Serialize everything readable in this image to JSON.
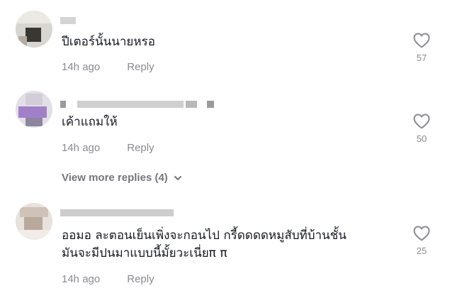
{
  "comments": [
    {
      "text_lines": [
        "ปีเตอร์นั้นนายหรอ"
      ],
      "time": "14h ago",
      "reply": "Reply",
      "likes": "57"
    },
    {
      "text_lines": [
        "เค้าแถมให้"
      ],
      "time": "14h ago",
      "reply": "Reply",
      "likes": "50"
    },
    {
      "text_lines": [
        "ออมอ ละตอนเย็นเพิ่งจะกอนไป กรี้ดดดดหมูสับที่บ้านชั้น",
        "มันจะมีปนมาแบบนี้มั้ยวะเนี่ยπ π"
      ],
      "time": "14h ago",
      "reply": "Reply",
      "likes": "25"
    }
  ],
  "view_more": "View more replies (4)",
  "icons": {
    "like": "heart-outline-icon",
    "expand": "chevron-down-icon"
  },
  "colors": {
    "text": "#161823",
    "meta": "#8a8b91",
    "icon": "#8a8b91"
  }
}
